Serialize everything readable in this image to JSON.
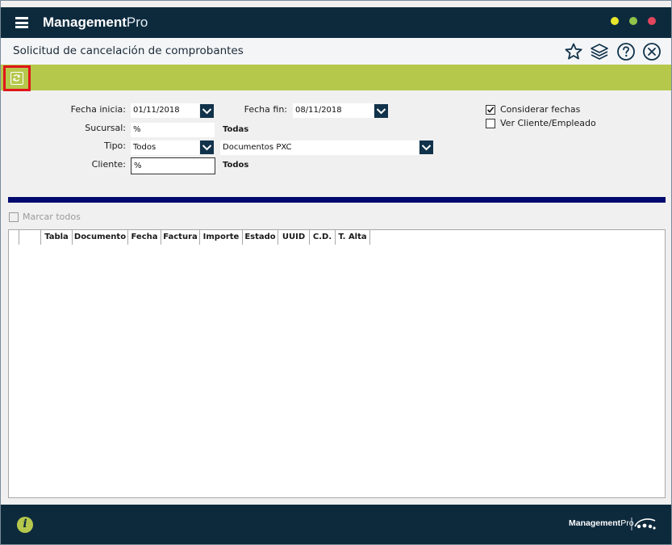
{
  "app": {
    "title_bold": "Management",
    "title_light": "Pro"
  },
  "header": {
    "page_title": "Solicitud de cancelación de comprobantes"
  },
  "form": {
    "fecha_inicia_label": "Fecha inicia:",
    "fecha_inicia_value": "01/11/2018",
    "fecha_fin_label": "Fecha fin:",
    "fecha_fin_value": "08/11/2018",
    "sucursal_label": "Sucursal:",
    "sucursal_value": "%",
    "sucursal_desc": "Todas",
    "tipo_label": "Tipo:",
    "tipo_value": "Todos",
    "documentos_value": "Documentos PXC",
    "cliente_label": "Cliente:",
    "cliente_value": "%",
    "cliente_desc": "Todos",
    "considerar_fechas_label": "Considerar fechas",
    "considerar_fechas_checked": true,
    "ver_cliente_label": "Ver Cliente/Empleado",
    "ver_cliente_checked": false
  },
  "grid": {
    "marcar_todos_label": "Marcar todos",
    "columns": [
      "",
      "",
      "Tabla",
      "Documento",
      "Fecha",
      "Factura",
      "Importe",
      "Estado",
      "UUID",
      "C.D.",
      "T. Alta"
    ],
    "rows": []
  },
  "footer": {
    "logo_bold": "Management",
    "logo_light": "Pro"
  },
  "colors": {
    "titlebar": "#0d2a3d",
    "toolbar": "#b5c84c",
    "navy_bar": "#000a6e",
    "highlight": "#e1151b"
  },
  "icons": {
    "menu": "hamburger-icon",
    "favorite": "star-icon",
    "layers": "layers-icon",
    "help": "help-icon",
    "close": "close-icon",
    "refresh": "refresh-icon",
    "info": "info-icon"
  }
}
